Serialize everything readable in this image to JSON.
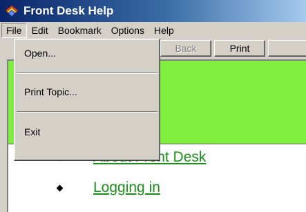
{
  "window": {
    "title": "Front Desk Help",
    "icon": "help-book-icon"
  },
  "menubar": {
    "items": [
      "File",
      "Edit",
      "Bookmark",
      "Options",
      "Help"
    ]
  },
  "toolbar": {
    "buttons": [
      {
        "label": "Back",
        "enabled": false
      },
      {
        "label": "Print",
        "enabled": true
      }
    ]
  },
  "file_menu": {
    "items": [
      "Open...",
      "Print Topic...",
      "Exit"
    ]
  },
  "content": {
    "band_color": "#7fee3e",
    "link_color": "#1a8f1a",
    "topics": [
      "About Front Desk",
      "Logging in"
    ]
  }
}
